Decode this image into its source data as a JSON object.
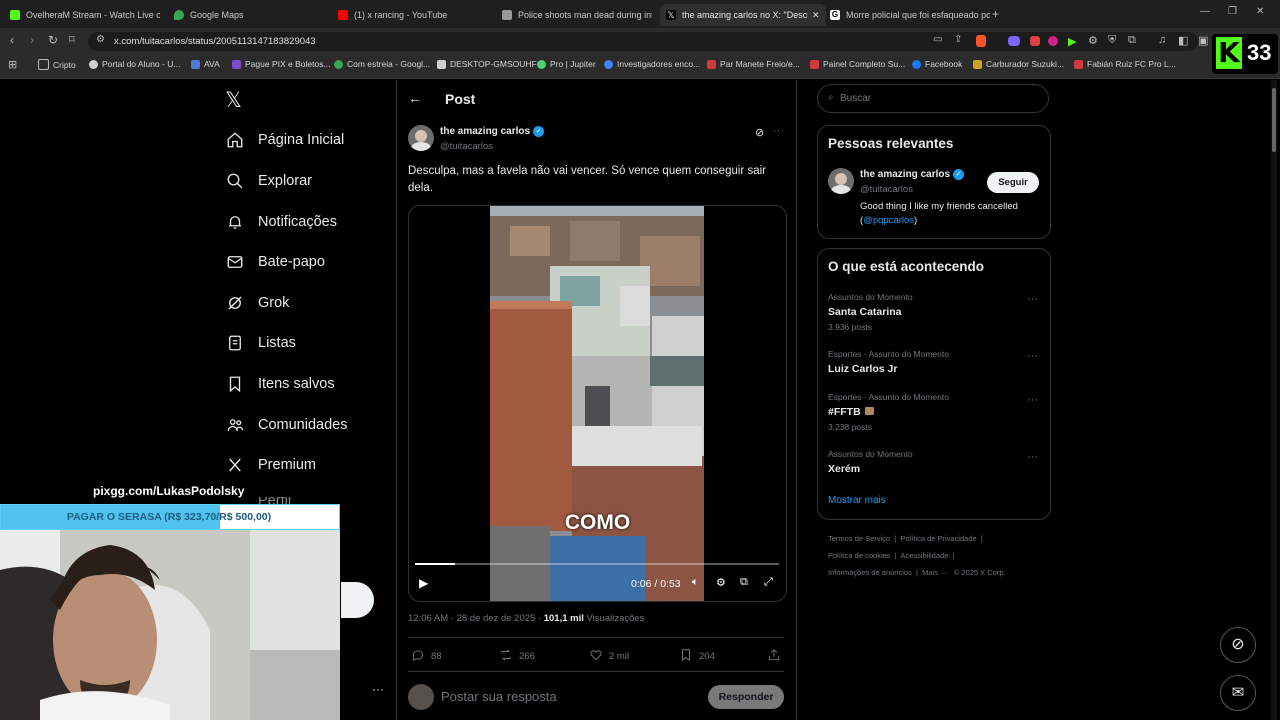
{
  "browser": {
    "tabs": [
      {
        "title": "OvelheraM Stream - Watch Live o",
        "color": "#53fc18"
      },
      {
        "title": "Google Maps",
        "color": "#34a853"
      },
      {
        "title": "(1) x rancing - YouTube",
        "color": "#ff0000"
      },
      {
        "title": "Police shoots man dead during inter",
        "color": "#9a9a9a"
      },
      {
        "title": "the amazing carlos no X: \"Descul",
        "color": "#ffffff"
      },
      {
        "title": "Morre policial que foi esfaqueado po",
        "color": "#ffffff"
      }
    ],
    "url": "x.com/tuitacarlos/status/2005113147183829043",
    "bookmarks": [
      {
        "label": "Cripto",
        "color": "#9aa0a6"
      },
      {
        "label": "Portal do Aluno - U...",
        "color": "#d0d0d0"
      },
      {
        "label": "AVA",
        "color": "#4a7bd0"
      },
      {
        "label": "Pague PIX e Boletos...",
        "color": "#7b4bd0"
      },
      {
        "label": "Com estreia - Googl...",
        "color": "#34a853"
      },
      {
        "label": "DESKTOP-GMSOUHF",
        "color": "#cfcfcf"
      },
      {
        "label": "Pro | Jupiter",
        "color": "#4ad07b"
      },
      {
        "label": "Investigadores enco...",
        "color": "#4285f4"
      },
      {
        "label": "Par Manete Freio/e...",
        "color": "#d03a3a"
      },
      {
        "label": "Painel Completo Su...",
        "color": "#d03a3a"
      },
      {
        "label": "Facebook",
        "color": "#1877f2"
      },
      {
        "label": "Carburador Suzuki...",
        "color": "#d0a020"
      },
      {
        "label": "Fabián Ruiz FC Pro L...",
        "color": "#d03a3a"
      }
    ],
    "kick_count": "33"
  },
  "sidebar": {
    "items": [
      {
        "label": "Página Inicial"
      },
      {
        "label": "Explorar"
      },
      {
        "label": "Notificações"
      },
      {
        "label": "Bate-papo"
      },
      {
        "label": "Grok"
      },
      {
        "label": "Listas"
      },
      {
        "label": "Itens salvos"
      },
      {
        "label": "Comunidades"
      },
      {
        "label": "Premium"
      }
    ],
    "partial_item": "Perfil"
  },
  "overlay": {
    "pix_link": "pixgg.com/LukasPodolsky",
    "goal_text": "PAGAR O SERASA (R$ 323,70/R$ 500,00)",
    "goal_progress": 0.647
  },
  "post": {
    "header": "Post",
    "author_name": "the amazing carlos",
    "author_handle": "@tuitacarlos",
    "text": "Desculpa, mas a favela não vai vencer. Só vence quem conseguir sair dela.",
    "video_caption": "COMO",
    "video_time": "0:06 / 0:53",
    "video_progress": 0.11,
    "timestamp": "12:06 AM · 28 de dez de 2025 · ",
    "views_count": "101,1 mil",
    "views_label": " Visualizações",
    "stats": {
      "replies": "88",
      "reposts": "266",
      "likes": "2 mil",
      "bookmarks": "204"
    },
    "reply_placeholder": "Postar sua resposta",
    "reply_button": "Responder"
  },
  "right": {
    "search_placeholder": "Buscar",
    "relevant_title": "Pessoas relevantes",
    "relevant_name": "the amazing carlos",
    "relevant_handle": "@tuitacarlos",
    "follow_label": "Seguir",
    "bio_text": "Good thing I like my friends cancelled (",
    "bio_mention": "@pqpcarlos",
    "bio_end": ")",
    "trends_title": "O que está acontecendo",
    "trends": [
      {
        "category": "Assuntos do Momento",
        "name": "Santa Catarina",
        "count": "3.936 posts"
      },
      {
        "category": "Esportes · Assunto do Momento",
        "name": "Luiz Carlos Jr",
        "count": ""
      },
      {
        "category": "Esportes · Assunto do Momento",
        "name": "#FFTB",
        "count": "3.238 posts"
      },
      {
        "category": "Assuntos do Momento",
        "name": "Xerém",
        "count": ""
      }
    ],
    "show_more": "Mostrar mais",
    "footer": [
      "Termos de Serviço",
      "Política de Privacidade",
      "Política de cookies",
      "Acessibilidade",
      "Informações de anúncios",
      "Mais ···",
      "© 2025 X Corp."
    ]
  }
}
